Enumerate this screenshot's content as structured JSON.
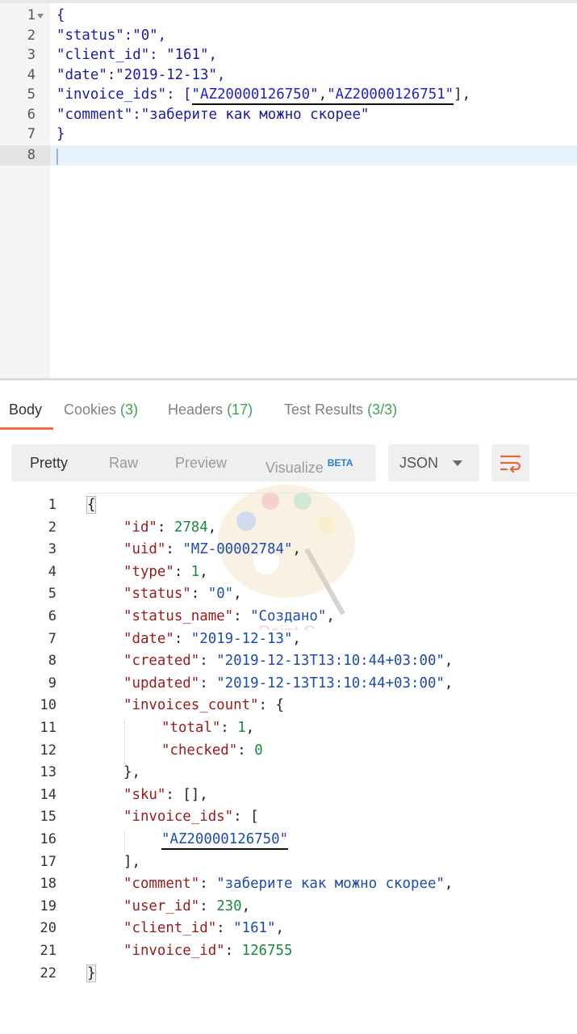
{
  "request": {
    "lines": [
      {
        "num": "1",
        "text": "{"
      },
      {
        "num": "2",
        "text": "\"status\":\"0\","
      },
      {
        "num": "3",
        "text": "\"client_id\": \"161\","
      },
      {
        "num": "4",
        "text": "\"date\":\"2019-12-13\","
      },
      {
        "num": "5",
        "text_prefix": "\"invoice_ids\": [",
        "id1": "\"AZ20000126750\"",
        "sep": ",",
        "id2": "\"AZ20000126751\"",
        "text_suffix": "],"
      },
      {
        "num": "6",
        "text": "\"comment\":\"заберите как можно скорее\""
      },
      {
        "num": "7",
        "text": "}"
      },
      {
        "num": "8",
        "text": ""
      }
    ]
  },
  "tabs": [
    {
      "label": "Body",
      "count": ""
    },
    {
      "label": "Cookies",
      "count": "(3)"
    },
    {
      "label": "Headers",
      "count": "(17)"
    },
    {
      "label": "Test Results",
      "count": "(3/3)"
    }
  ],
  "toolbar": {
    "pretty": "Pretty",
    "raw": "Raw",
    "preview": "Preview",
    "visualize": "Visualize",
    "beta": "BETA",
    "format": "JSON"
  },
  "watermark_text": "Paint S",
  "response": {
    "lines": [
      {
        "num": "1",
        "k": "",
        "rest": "{"
      },
      {
        "num": "2",
        "k": "\"id\"",
        "v": "2784",
        "vt": "n",
        "end": ","
      },
      {
        "num": "3",
        "k": "\"uid\"",
        "v": "\"MZ-00002784\"",
        "vt": "s",
        "end": ","
      },
      {
        "num": "4",
        "k": "\"type\"",
        "v": "1",
        "vt": "n",
        "end": ","
      },
      {
        "num": "5",
        "k": "\"status\"",
        "v": "\"0\"",
        "vt": "s",
        "end": ","
      },
      {
        "num": "6",
        "k": "\"status_name\"",
        "v": "\"Создано\"",
        "vt": "s",
        "end": ","
      },
      {
        "num": "7",
        "k": "\"date\"",
        "v": "\"2019-12-13\"",
        "vt": "s",
        "end": ","
      },
      {
        "num": "8",
        "k": "\"created\"",
        "v": "\"2019-12-13T13:10:44+03:00\"",
        "vt": "s",
        "end": ","
      },
      {
        "num": "9",
        "k": "\"updated\"",
        "v": "\"2019-12-13T13:10:44+03:00\"",
        "vt": "s",
        "end": ","
      },
      {
        "num": "10",
        "k": "\"invoices_count\"",
        "v": "{",
        "vt": "p",
        "end": ""
      },
      {
        "num": "11",
        "k": "\"total\"",
        "v": "1",
        "vt": "n",
        "end": ",",
        "deep": true
      },
      {
        "num": "12",
        "k": "\"checked\"",
        "v": "0",
        "vt": "n",
        "end": "",
        "deep": true
      },
      {
        "num": "13",
        "k": "",
        "rest": "},"
      },
      {
        "num": "14",
        "k": "\"sku\"",
        "v": "[]",
        "vt": "p",
        "end": ","
      },
      {
        "num": "15",
        "k": "\"invoice_ids\"",
        "v": "[",
        "vt": "p",
        "end": ""
      },
      {
        "num": "16",
        "k": "",
        "sval": "\"AZ20000126750\"",
        "deep": true
      },
      {
        "num": "17",
        "k": "",
        "rest": "],"
      },
      {
        "num": "18",
        "k": "\"comment\"",
        "v": "\"заберите как можно скорее\"",
        "vt": "s",
        "end": ","
      },
      {
        "num": "19",
        "k": "\"user_id\"",
        "v": "230",
        "vt": "n",
        "end": ","
      },
      {
        "num": "20",
        "k": "\"client_id\"",
        "v": "\"161\"",
        "vt": "s",
        "end": ","
      },
      {
        "num": "21",
        "k": "\"invoice_id\"",
        "v": "126755",
        "vt": "n",
        "end": ""
      },
      {
        "num": "22",
        "k": "",
        "rest": "}",
        "top": true
      }
    ]
  }
}
